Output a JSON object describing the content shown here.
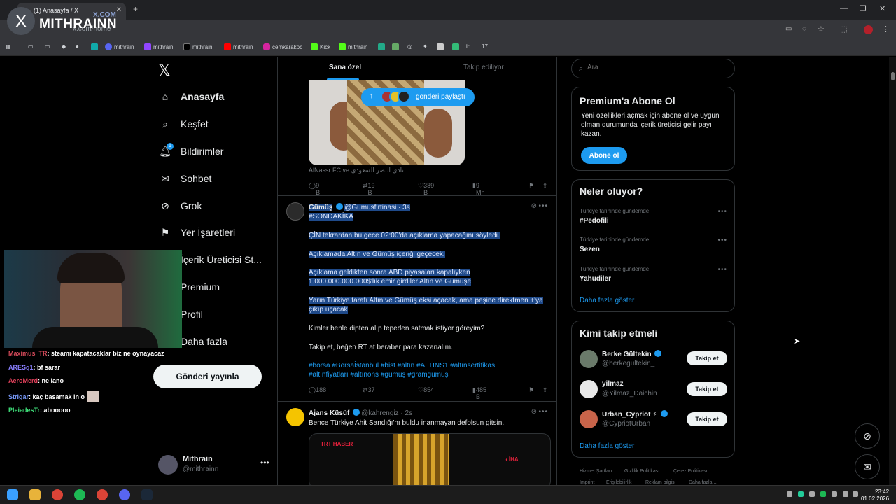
{
  "browser": {
    "tab_title": "(1) Anasayfa / X",
    "url": "x.com/home",
    "bookmarks": [
      "mithrain",
      "mithrain",
      "mithrain",
      "mithrain",
      "cemkarakoc",
      "Kick",
      "mithrain"
    ]
  },
  "overlay": {
    "brand": "MITHRAINN",
    "brand_sub": "X.COM"
  },
  "nav": {
    "items": [
      "Anasayfa",
      "Keşfet",
      "Bildirimler",
      "Sohbet",
      "Grok",
      "Yer İşaretleri",
      "İçerik Üreticisi St...",
      "Premium",
      "Profil",
      "Daha fazla"
    ],
    "notification_badge": "1",
    "post_button": "Gönderi yayınla",
    "profile_name": "Mithrain",
    "profile_handle": "@mithrainn"
  },
  "chat": [
    {
      "user": "Maximus_TR",
      "color": "#d64a5a",
      "msg": ": steamı kapatacaklar biz ne oynayacaz"
    },
    {
      "user": "ARESq1",
      "color": "#8a7fff",
      "msg": ": bf sarar"
    },
    {
      "user": "AeroMerd",
      "color": "#e0405a",
      "msg": ": ne lano"
    },
    {
      "user": "Strigar",
      "color": "#7a9cff",
      "msg": ": kaç basamak in o"
    },
    {
      "user": "PleiadesTr",
      "color": "#3fe07a",
      "msg": ": abooooo"
    }
  ],
  "feed": {
    "tabs": [
      "Sana özel",
      "Takip ediliyor"
    ],
    "share_pill": "gönderi paylaştı",
    "tweet0": {
      "caption": "AlNassr FC ve نادي النصر السعودي",
      "replies": "9 B",
      "retweets": "19 B",
      "likes": "389 B",
      "views": "9 Mn"
    },
    "tweet1": {
      "name": "Gümüş",
      "handle": "@Gumusfirtinasi",
      "time": "· 3s",
      "lines": [
        "#SONDAKİKA",
        "ÇİN tekrardan bu gece 02:00'da açıklama yapacağını söyledi.",
        "Açıklamada Altın ve Gümüş içeriği geçecek.",
        "Açıklama geldikten sonra ABD piyasaları kapalıyken",
        "1.000.000.000.000$'lık emir girdiler Altın ve Gümüşe",
        "Yarın Türkiye tarafı Altın ve Gümüş eksi açacak, ama peşine direktmen +'ya",
        "çıkıp uçacak",
        "Kimler benle dipten alıp tepeden satmak istiyor göreyim?",
        "Takip et, beğen RT at beraber para kazanalım.",
        "#borsa #Borsaİstanbul #bist #altın #ALTINS1 #altınsertifikası",
        "#altınfiyatları #altınons #gümüş #gramgümüş"
      ],
      "replies": "188",
      "retweets": "37",
      "likes": "854",
      "views": "485 B"
    },
    "tweet2": {
      "name": "Ajans Küsüf",
      "handle": "@kahrengiz",
      "time": "· 2s",
      "text": "Bence Türkiye Ahit Sandığı'nı buldu inanmayan defolsun gitsin.",
      "media_label_a": "TRT",
      "media_label_b": "HABER",
      "media_label_c": "İHA"
    }
  },
  "right": {
    "search_placeholder": "Ara",
    "premium": {
      "title": "Premium'a Abone Ol",
      "desc": "Yeni özellikleri açmak için abone ol ve uygun olman durumunda içerik üreticisi gelir payı kazan.",
      "button": "Abone ol"
    },
    "trends": {
      "title": "Neler oluyor?",
      "items": [
        {
          "ctx": "Türkiye tarihinde gündemde",
          "name": "#Pedofili"
        },
        {
          "ctx": "Türkiye tarihinde gündemde",
          "name": "Sezen"
        },
        {
          "ctx": "Türkiye tarihinde gündemde",
          "name": "Yahudiler"
        }
      ],
      "more": "Daha fazla göster"
    },
    "who": {
      "title": "Kimi takip etmeli",
      "items": [
        {
          "name": "Berke Gültekin",
          "handle": "@berkegultekin_",
          "btn": "Takip et"
        },
        {
          "name": "yilmaz",
          "handle": "@Yilmaz_Daichin",
          "btn": "Takip et"
        },
        {
          "name": "Urban_Cypriot ⚡",
          "handle": "@CypriotUrban",
          "btn": "Takip et"
        }
      ],
      "more": "Daha fazla göster"
    },
    "footer": [
      "Hizmet Şartları",
      "Gizlilik Politikası",
      "Çerez Politikası",
      "Imprint",
      "Erişilebilirlik",
      "Reklam bilgisi",
      "Daha fazla ..."
    ]
  },
  "taskbar": {
    "time": "23:42",
    "date": "01.02.2026"
  }
}
